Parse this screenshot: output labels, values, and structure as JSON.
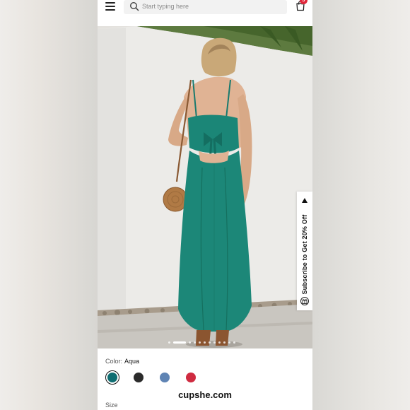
{
  "header": {
    "menu_icon": "hamburger-menu-icon",
    "search": {
      "placeholder": "Start typing here",
      "icon": "search-icon"
    },
    "bag": {
      "icon": "shopping-bag-icon",
      "count": "3"
    }
  },
  "hero": {
    "image_description": "product-photo",
    "carousel": {
      "total": 12,
      "active": 0
    }
  },
  "subscribe_tab": {
    "label": "Subscribe to Get 20% Off",
    "arrow_icon": "triangle-up-icon",
    "gift_icon": "gift-icon"
  },
  "product": {
    "color_label": "Color:",
    "color_value": "Aqua",
    "swatches": [
      {
        "name": "Aqua",
        "color": "#0f6e72",
        "selected": true
      },
      {
        "name": "Black",
        "color": "#2b2b2b",
        "selected": false
      },
      {
        "name": "Blue",
        "color": "#5f84b4",
        "selected": false
      },
      {
        "name": "Red",
        "color": "#cf2b40",
        "selected": false
      }
    ],
    "size_label": "Size"
  },
  "watermark": {
    "text": "cupshe.com"
  }
}
